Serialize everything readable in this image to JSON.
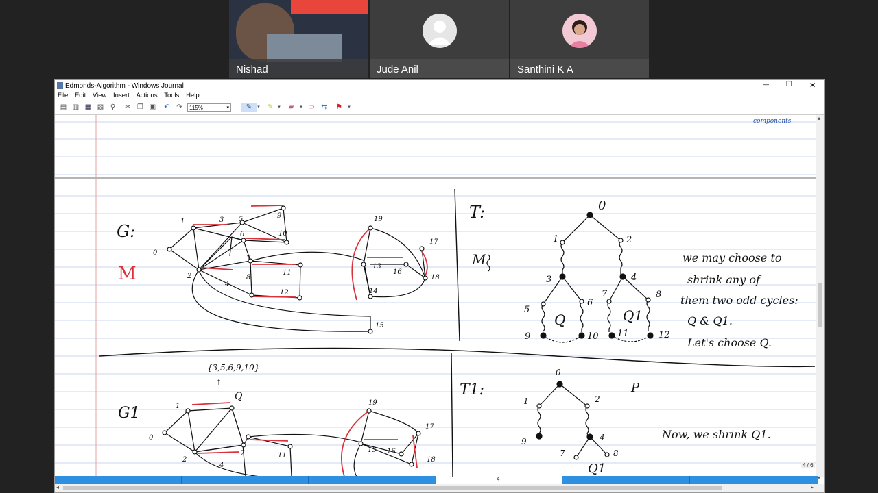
{
  "participants": [
    {
      "name": "Nishad"
    },
    {
      "name": "Jude Anil"
    },
    {
      "name": "Santhini K A"
    }
  ],
  "window": {
    "title": "Edmonds-Algorithm - Windows Journal",
    "min_glyph": "—",
    "max_glyph": "❐",
    "close_glyph": "✕"
  },
  "menu": [
    "File",
    "Edit",
    "View",
    "Insert",
    "Actions",
    "Tools",
    "Help"
  ],
  "toolbar": {
    "zoom": "115%"
  },
  "footer": {
    "page_number": "4",
    "page_indicator": "4 / 6"
  },
  "notes": {
    "top_right": "components",
    "g_label": "G:",
    "m_label": "M",
    "t_label": "T:",
    "m_right": "M",
    "para1": [
      "we may choose to",
      "shrink any of",
      "them two odd cycles:",
      "Q & Q1.",
      "Let's choose Q."
    ],
    "set_label": "{3,5,6,9,10}",
    "g1_label": "G1",
    "t1_label": "T1:",
    "p_label": "P",
    "para2": "Now, we shrink Q1."
  },
  "colors": {
    "matching": "#d9323a",
    "ink": "#111111",
    "rule": "#c9d7ee",
    "margin": "#e6a0a0"
  }
}
